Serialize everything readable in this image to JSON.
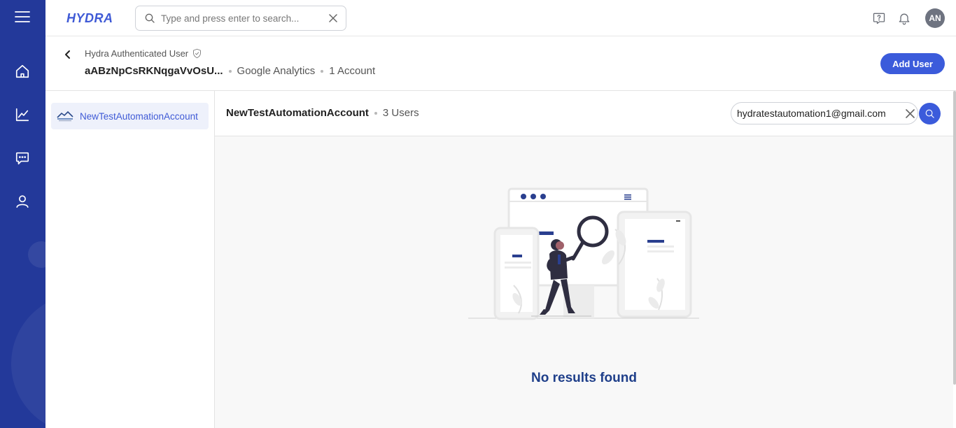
{
  "app": {
    "logo_text": "HYDRA",
    "search_placeholder": "Type and press enter to search...",
    "avatar_initials": "AN"
  },
  "nav": {
    "items": [
      {
        "name": "home",
        "icon": "home-icon"
      },
      {
        "name": "analytics",
        "icon": "chart-line-icon"
      },
      {
        "name": "messages",
        "icon": "chat-icon"
      },
      {
        "name": "users",
        "icon": "user-icon"
      }
    ]
  },
  "header": {
    "subtitle": "Hydra Authenticated User",
    "user_id": "aABzNpCsRKNqgaVvOsU...",
    "platform": "Google Analytics",
    "account_count": "1 Account",
    "add_user_label": "Add User"
  },
  "accounts": [
    {
      "label": "NewTestAutomationAccount",
      "selected": true
    }
  ],
  "main": {
    "account_name": "NewTestAutomationAccount",
    "user_count": "3 Users",
    "search_value": "hydratestautomation1@gmail.com",
    "empty_message": "No results found"
  },
  "colors": {
    "rail": "#23399a",
    "accent": "#3b5bdb",
    "empty_text": "#1f3f8a"
  }
}
